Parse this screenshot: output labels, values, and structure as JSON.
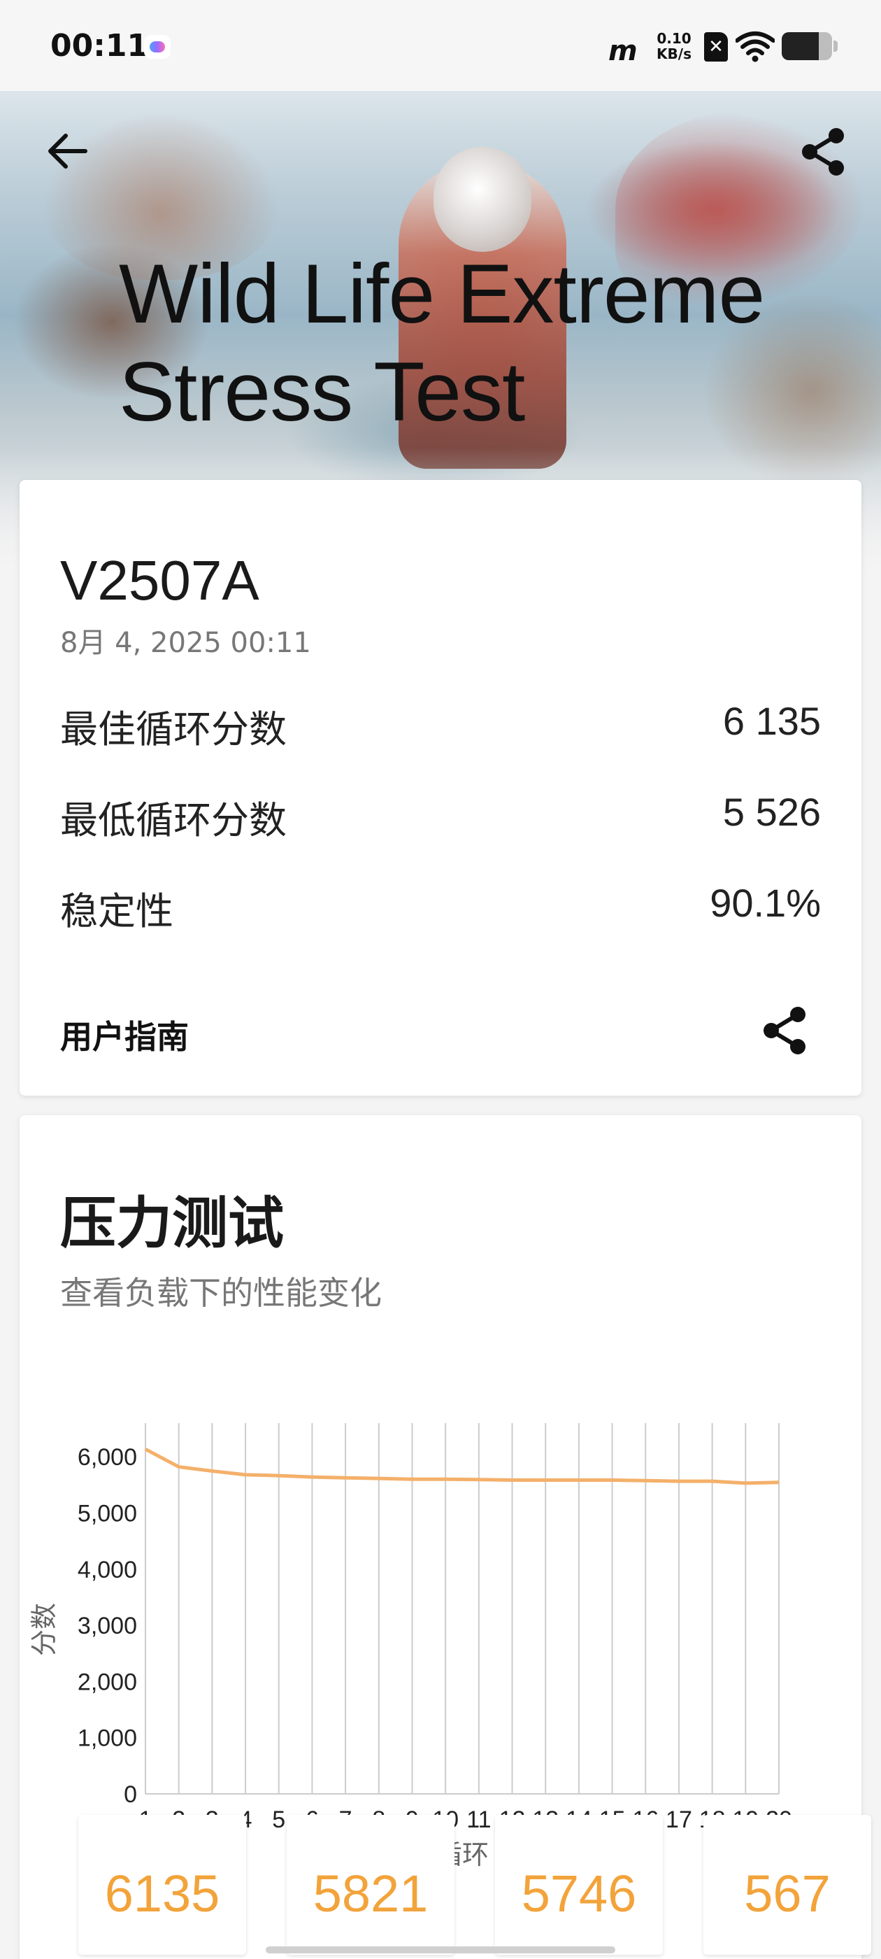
{
  "status_bar": {
    "time": "00:11",
    "net_logo": "m",
    "speed_value": "0.10",
    "speed_unit": "KB/s",
    "sim_label": "✕",
    "battery_level": 0.74
  },
  "header": {
    "title": "Wild Life Extreme Stress Test",
    "back_icon": "arrow-left-icon",
    "share_icon": "share-icon"
  },
  "result": {
    "device": "V2507A",
    "date": "8月 4, 2025 00:11",
    "rows": [
      {
        "label": "最佳循环分数",
        "value": "6 135"
      },
      {
        "label": "最低循环分数",
        "value": "5 526"
      },
      {
        "label": "稳定性",
        "value": "90.1%"
      }
    ],
    "guide_label": "用户指南",
    "share_icon": "share-icon"
  },
  "stress": {
    "title": "压力测试",
    "subtitle": "查看负载下的性能变化",
    "tiles": [
      "6135",
      "5821",
      "5746",
      "567"
    ]
  },
  "colors": {
    "accent": "#f2a33a",
    "line": "#f4b06a",
    "grid": "#cccccc"
  },
  "chart_data": {
    "type": "line",
    "xlabel": "循环",
    "ylabel": "分数",
    "x": [
      1,
      2,
      3,
      4,
      5,
      6,
      7,
      8,
      9,
      10,
      11,
      12,
      13,
      14,
      15,
      16,
      17,
      18,
      19,
      20
    ],
    "series": [
      {
        "values": [
          6135,
          5821,
          5746,
          5680,
          5665,
          5640,
          5625,
          5615,
          5600,
          5600,
          5595,
          5585,
          5585,
          5585,
          5585,
          5575,
          5565,
          5565,
          5530,
          5545
        ]
      }
    ],
    "ylim": [
      0,
      6000
    ],
    "yticks": [
      "0",
      "1,000",
      "2,000",
      "3,000",
      "4,000",
      "5,000",
      "6,000"
    ],
    "xticks": [
      "1",
      "2",
      "3",
      "4",
      "5",
      "6",
      "7",
      "8",
      "9",
      "10",
      "11",
      "12",
      "13",
      "14",
      "15",
      "16",
      "17",
      "18",
      "19",
      "20"
    ],
    "grid": "vertical"
  }
}
